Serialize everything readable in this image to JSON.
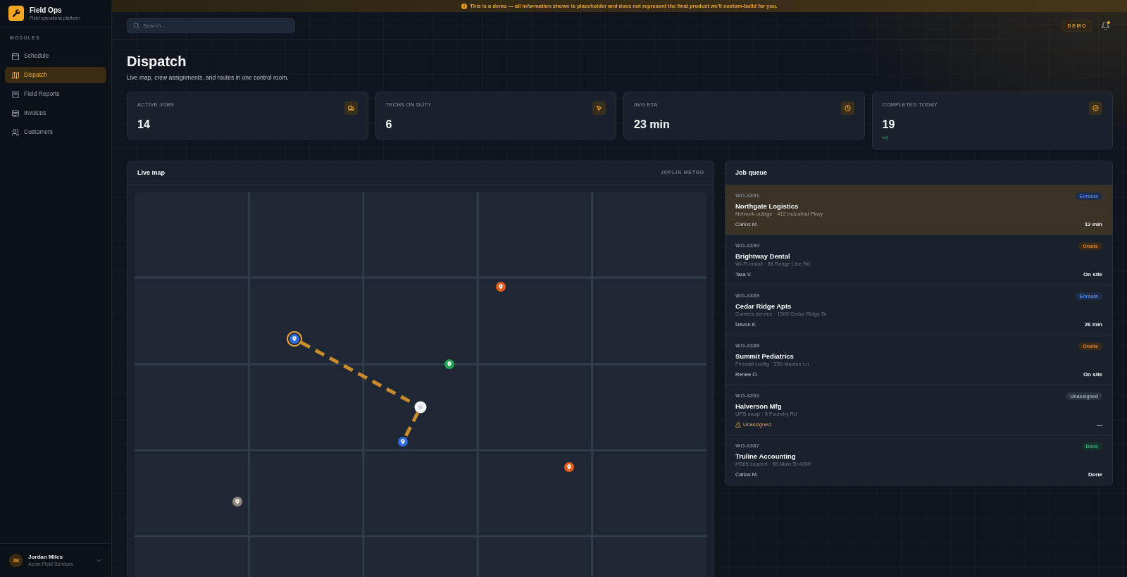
{
  "banner": {
    "text": "This is a demo — all information shown is placeholder and does not represent the final product we'll custom-build for you."
  },
  "sidebar": {
    "brand": {
      "title": "Field Ops",
      "subtitle": "Field operations platform"
    },
    "section": "MODULES",
    "items": [
      {
        "label": "Schedule",
        "selected": false
      },
      {
        "label": "Dispatch",
        "selected": true
      },
      {
        "label": "Field Reports",
        "selected": false
      },
      {
        "label": "Invoices",
        "selected": false
      },
      {
        "label": "Customers",
        "selected": false
      }
    ],
    "user": {
      "initials": "JM",
      "name": "Jordan Miles",
      "org": "Acme Field Services"
    }
  },
  "topbar": {
    "search": {
      "placeholder": "Search..."
    },
    "badge": "DEMO",
    "notifications": {
      "unread": true
    }
  },
  "page": {
    "title": "Dispatch",
    "subtitle": "Live map, crew assignments, and routes in one control room."
  },
  "stats": [
    {
      "label": "ACTIVE JOBS",
      "value": "14"
    },
    {
      "label": "TECHS ON DUTY",
      "value": "6"
    },
    {
      "label": "AVG ETA",
      "value": "23 min"
    },
    {
      "label": "COMPLETED TODAY",
      "value": "19",
      "delta": "+4"
    }
  ],
  "map": {
    "title": "Live map",
    "region": "JOPLIN METRO",
    "pins": [
      {
        "kind": "job",
        "color": "#e5591a",
        "selected": false
      },
      {
        "kind": "job",
        "color": "#2f6ae0",
        "selected": true
      },
      {
        "kind": "job",
        "color": "#23a052",
        "selected": false
      },
      {
        "kind": "crew",
        "color": "#f2f3f5",
        "selected": false
      },
      {
        "kind": "job",
        "color": "#2f6ae0",
        "selected": false
      },
      {
        "kind": "job",
        "color": "#e5591a",
        "selected": false
      },
      {
        "kind": "job",
        "color": "#8e857c",
        "selected": false
      }
    ]
  },
  "job_queue": {
    "title": "Job queue",
    "jobs": [
      {
        "id": "WO-3391",
        "status": {
          "label": "Enroute",
          "kind": "enroute"
        },
        "name": "Northgate Logistics",
        "detail": "Network outage · 412 Industrial Pkwy",
        "assignee": "Carlos M.",
        "unassigned": false,
        "eta": "12 min",
        "selected": true
      },
      {
        "id": "WO-3390",
        "status": {
          "label": "Onsite",
          "kind": "onsite"
        },
        "name": "Brightway Dental",
        "detail": "Wi-Fi install · 88 Range Line Rd",
        "assignee": "Tara V.",
        "unassigned": false,
        "eta": "On site",
        "selected": false
      },
      {
        "id": "WO-3389",
        "status": {
          "label": "Enroute",
          "kind": "enroute"
        },
        "name": "Cedar Ridge Apts",
        "detail": "Camera service · 1500 Cedar Ridge Dr",
        "assignee": "Devon K.",
        "unassigned": false,
        "eta": "26 min",
        "selected": false
      },
      {
        "id": "WO-3388",
        "status": {
          "label": "Onsite",
          "kind": "onsite"
        },
        "name": "Summit Pediatrics",
        "detail": "Firewall config · 230 Maiden Ln",
        "assignee": "Renee O.",
        "unassigned": false,
        "eta": "On site",
        "selected": false
      },
      {
        "id": "WO-3392",
        "status": {
          "label": "Unassigned",
          "kind": "unassigned"
        },
        "name": "Halverson Mfg",
        "detail": "UPS swap · 9 Foundry Rd",
        "assignee": "Unassigned",
        "unassigned": true,
        "eta": "—",
        "selected": false
      },
      {
        "id": "WO-3387",
        "status": {
          "label": "Done",
          "kind": "done"
        },
        "name": "Truline Accounting",
        "detail": "M365 support · 55 Main St #200",
        "assignee": "Carlos M.",
        "unassigned": false,
        "eta": "Done",
        "selected": false
      }
    ]
  }
}
